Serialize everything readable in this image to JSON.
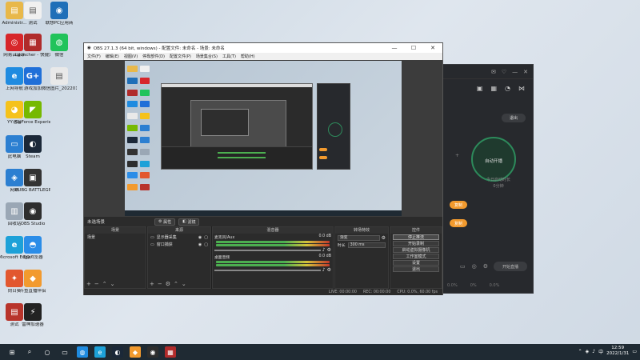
{
  "desktop_icons": [
    {
      "label": "Administr...",
      "color": "#e8b84a",
      "glyph": "▤"
    },
    {
      "label": "测试",
      "color": "#f0f0f0",
      "glyph": "▤"
    },
    {
      "label": "联想PC应用商",
      "color": "#1f6fb8",
      "glyph": "◉"
    },
    {
      "label": "网易云音乐",
      "color": "#d7262b",
      "glyph": "◎"
    },
    {
      "label": "Launcher - 快捷方式",
      "color": "#b02b2b",
      "glyph": "▦"
    },
    {
      "label": "微信",
      "color": "#21c35b",
      "glyph": "◍"
    },
    {
      "label": "上网导航",
      "color": "#1f8be0",
      "glyph": "e"
    },
    {
      "label": "游戏加加",
      "color": "#1f6fd8",
      "glyph": "G+"
    },
    {
      "label": "微信图片_2022013...",
      "color": "#e9e9e9",
      "glyph": "▤"
    },
    {
      "label": "YY语音",
      "color": "#f5c21b",
      "glyph": "◕"
    },
    {
      "label": "GeForce Experience",
      "color": "#76b900",
      "glyph": "◤"
    },
    {
      "label": "此电脑",
      "color": "#2c7fd1",
      "glyph": "▭"
    },
    {
      "label": "Steam",
      "color": "#1b2838",
      "glyph": "◐"
    },
    {
      "label": "网络",
      "color": "#2c7fd1",
      "glyph": "◈"
    },
    {
      "label": "PUBG BATTLEGR...",
      "color": "#333333",
      "glyph": "▣"
    },
    {
      "label": "回收站",
      "color": "#9aa7b5",
      "glyph": "▥"
    },
    {
      "label": "OBS Studio",
      "color": "#2e2e2e",
      "glyph": "◉"
    },
    {
      "label": "Microsoft Edge",
      "color": "#1da1d8",
      "glyph": "e"
    },
    {
      "label": "QQ浏览器",
      "color": "#2b8de8",
      "glyph": "◓"
    },
    {
      "label": "向日葵",
      "color": "#e2572f",
      "glyph": "✦"
    },
    {
      "label": "斗鱼直播伴侣",
      "color": "#f29a2e",
      "glyph": "◆"
    },
    {
      "label": "测试",
      "color": "#b8342b",
      "glyph": "▤"
    },
    {
      "label": "雷神加速器",
      "color": "#222222",
      "glyph": "⚡"
    }
  ],
  "taskbar": {
    "apps": [
      {
        "glyph": "⊞",
        "color": "#1f2a33"
      },
      {
        "glyph": "⌕",
        "color": "#1f2a33"
      },
      {
        "glyph": "○",
        "color": "#1f2a33"
      },
      {
        "glyph": "▭",
        "color": "#1f2a33"
      },
      {
        "glyph": "◍",
        "color": "#1f8be0"
      },
      {
        "glyph": "e",
        "color": "#1da1d8"
      },
      {
        "glyph": "◐",
        "color": "#1b2838"
      },
      {
        "glyph": "◆",
        "color": "#f29a2e"
      },
      {
        "glyph": "◉",
        "color": "#2e2e2e"
      },
      {
        "glyph": "▦",
        "color": "#b02b2b"
      }
    ],
    "time": "12:59",
    "date": "2022/1/31"
  },
  "bgapp": {
    "logout": "退出",
    "center_btn": "自动开播",
    "center_text": "今日启动时长",
    "center_subtext": "0分钟",
    "pill1": "复制",
    "pill2": "复制",
    "bottom_btn": "开始直播",
    "stats": [
      "0.0%",
      "0%",
      "0.0%"
    ]
  },
  "obs": {
    "title": "OBS 27.1.3 (64 bit, windows) - 配置文件: 未命名 - 场景: 未命名",
    "menu": [
      "文件(F)",
      "编辑(E)",
      "视图(V)",
      "停靠部件(D)",
      "配置文件(P)",
      "场景集合(S)",
      "工具(T)",
      "帮助(H)"
    ],
    "scene_label": "未选场景",
    "scene_btn1": "属性",
    "scene_btn2": "滤镜",
    "docks": {
      "scenes": {
        "title": "场景",
        "items": [
          "场景"
        ]
      },
      "sources": {
        "title": "来源",
        "items": [
          "显示器采集",
          "窗口捕获"
        ]
      },
      "mixer": {
        "title": "混音器",
        "channels": [
          {
            "name": "麦克风/Aux",
            "db": "0.0 dB"
          },
          {
            "name": "桌面音频",
            "db": "0.0 dB"
          }
        ]
      },
      "transitions": {
        "title": "转场特效",
        "type": "渐变",
        "duration_label": "时长",
        "duration": "300 ms"
      },
      "controls": {
        "title": "控件",
        "buttons": [
          "停止推流",
          "开始录制",
          "启动虚拟摄像机",
          "工作室模式",
          "设置",
          "退出"
        ]
      }
    },
    "status": {
      "live": "LIVE: 00:00:00",
      "rec": "REC: 00:00:00",
      "cpu": "CPU: 0.0%, 60.00 fps"
    }
  }
}
